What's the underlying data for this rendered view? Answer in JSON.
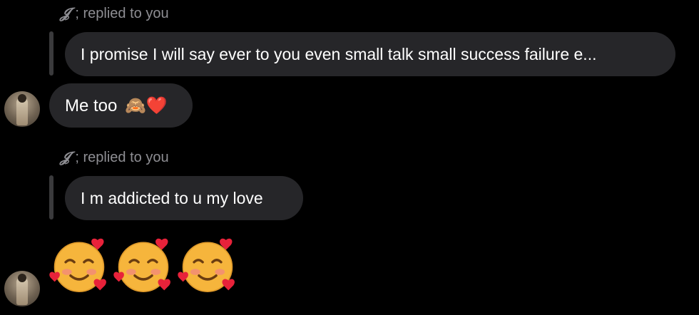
{
  "messages": {
    "reply1": {
      "sender_mark": "𝓙",
      "header_suffix": "; replied to you",
      "quoted_text": "I promise I will say ever to you even small talk small success failure e...",
      "message_text": "Me too",
      "message_emoji": "🙈❤️"
    },
    "reply2": {
      "sender_mark": "𝓙",
      "header_suffix": "; replied to you",
      "quoted_text": "I m addicted to u my love"
    },
    "emoji_message": {
      "emojis": [
        "🥰",
        "🥰",
        "🥰"
      ]
    }
  },
  "colors": {
    "background": "#000000",
    "bubble": "#262629",
    "reply_bar": "#3a3a3c",
    "muted_text": "#8e8e93",
    "heart": "#e8223a",
    "face": "#f6b53c"
  }
}
